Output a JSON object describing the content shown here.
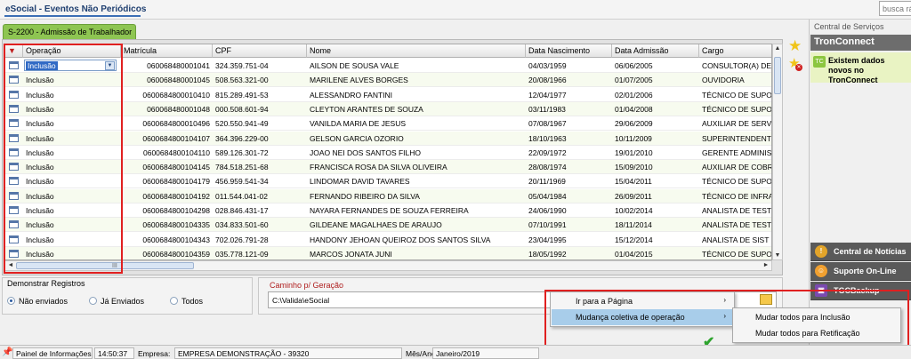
{
  "window": {
    "title": "eSocial - Eventos Não Periódicos",
    "search_placeholder": "busca rá"
  },
  "tab": {
    "label": "S-2200 - Admissão de Trabalhador"
  },
  "grid": {
    "columns": [
      "Operação",
      "Matrícula",
      "CPF",
      "Nome",
      "Data Nascimento",
      "Data Admissão",
      "Cargo"
    ],
    "rows": [
      [
        "Inclusão",
        "060068480001041",
        "324.359.751-04",
        "AILSON DE SOUSA VALE",
        "04/03/1959",
        "06/06/2005",
        "CONSULTOR(A) DE"
      ],
      [
        "Inclusão",
        "060068480001045",
        "508.563.321-00",
        "MARILENE ALVES BORGES",
        "20/08/1966",
        "01/07/2005",
        "OUVIDORIA"
      ],
      [
        "Inclusão",
        "0600684800010410",
        "815.289.491-53",
        "ALESSANDRO FANTINI",
        "12/04/1977",
        "02/01/2006",
        "TÉCNICO DE SUPOR"
      ],
      [
        "Inclusão",
        "060068480001048",
        "000.508.601-94",
        "CLEYTON ARANTES DE SOUZA",
        "03/11/1983",
        "01/04/2008",
        "TÉCNICO DE SUPOR"
      ],
      [
        "Inclusão",
        "0600684800010496",
        "520.550.941-49",
        "VANILDA MARIA DE JESUS",
        "07/08/1967",
        "29/06/2009",
        "AUXILIAR DE SERV"
      ],
      [
        "Inclusão",
        "0600684800104107",
        "364.396.229-00",
        "GELSON GARCIA OZORIO",
        "18/10/1963",
        "10/11/2009",
        "SUPERINTENDENTE"
      ],
      [
        "Inclusão",
        "0600684800104110",
        "589.126.301-72",
        "JOAO NEI DOS SANTOS FILHO",
        "22/09/1972",
        "19/01/2010",
        "GERENTE ADMINIST"
      ],
      [
        "Inclusão",
        "0600684800104145",
        "784.518.251-68",
        "FRANCISCA ROSA DA SILVA OLIVEIRA",
        "28/08/1974",
        "15/09/2010",
        "AUXILIAR DE COBR"
      ],
      [
        "Inclusão",
        "0600684800104179",
        "456.959.541-34",
        "LINDOMAR DAVID TAVARES",
        "20/11/1969",
        "15/04/2011",
        "TÉCNICO DE SUPOR"
      ],
      [
        "Inclusão",
        "0600684800104192",
        "011.544.041-02",
        "FERNANDO RIBEIRO DA SILVA",
        "05/04/1984",
        "26/09/2011",
        "TÉCNICO DE INFRA-"
      ],
      [
        "Inclusão",
        "0600684800104298",
        "028.846.431-17",
        "NAYARA FERNANDES DE SOUZA FERREIRA",
        "24/06/1990",
        "10/02/2014",
        "ANALISTA DE TEST"
      ],
      [
        "Inclusão",
        "0600684800104335",
        "034.833.501-60",
        "GILDEANE MAGALHAES DE ARAUJO",
        "07/10/1991",
        "18/11/2014",
        "ANALISTA DE TEST"
      ],
      [
        "Inclusão",
        "0600684800104343",
        "702.026.791-28",
        "HANDONY JEHOAN QUEIROZ DOS SANTOS SILVA",
        "23/04/1995",
        "15/12/2014",
        "ANALISTA DE SIST"
      ],
      [
        "Inclusão",
        "0600684800104359",
        "035.778.121-09",
        "MARCOS JONATA JUNI",
        "18/05/1992",
        "01/04/2015",
        "TÉCNICO DE SUPOR"
      ]
    ],
    "scroll_grip": "III"
  },
  "demonstrar": {
    "title": "Demonstrar Registros",
    "options": [
      "Não enviados",
      "Já Enviados",
      "Todos"
    ],
    "selected": "Não enviados"
  },
  "caminho": {
    "title": "Caminho p/ Geração",
    "value": "C:\\Valida\\eSocial"
  },
  "context_menu": {
    "items": [
      "Ir para a Página",
      "Mudança coletiva de operação"
    ],
    "submenu": [
      "Mudar todos para Inclusão",
      "Mudar todos para Retificação"
    ]
  },
  "right_panel": {
    "title": "Central de Serviços",
    "tron_title": "TronConnect",
    "tron_msg": "Existem dados novos no TronConnect",
    "buttons": [
      "Central de Notícias",
      "Suporte On-Line",
      "TGCBackup"
    ]
  },
  "statusbar": {
    "painel": "Painel de Informações",
    "time": "14:50:37",
    "empresa_label": "Empresa:",
    "empresa_value": "EMPRESA DEMONSTRAÇÃO - 39320",
    "mesano_label": "Mês/Ano:",
    "mesano_value": "Janeiro/2019"
  },
  "colors": {
    "tab_green": "#8ec552",
    "highlight": "#a8cdea",
    "annotation_red": "#e02020"
  }
}
